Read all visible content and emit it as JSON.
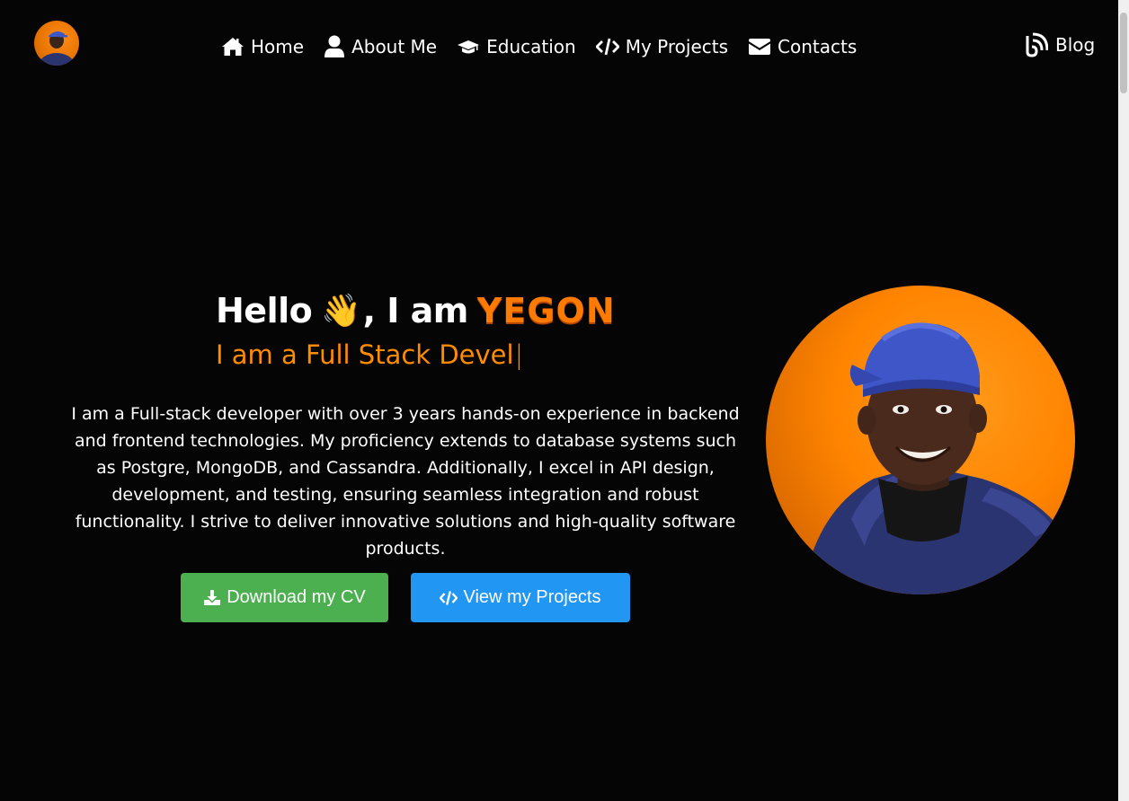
{
  "nav": {
    "logo_alt": "avatar",
    "items": [
      {
        "label": "Home",
        "icon": "home-icon"
      },
      {
        "label": "About Me",
        "icon": "user-icon"
      },
      {
        "label": "Education",
        "icon": "graduation-cap-icon"
      },
      {
        "label": "My Projects",
        "icon": "code-icon"
      },
      {
        "label": "Contacts",
        "icon": "envelope-icon"
      }
    ],
    "blog": {
      "label": "Blog",
      "icon": "blog-icon"
    }
  },
  "hero": {
    "greeting_prefix": "Hello",
    "wave_emoji": "👋",
    "greeting_mid": ", I am",
    "name": "YEGON",
    "typed_text": "I am a Full Stack Devel",
    "cursor": "|",
    "bio": "I am a Full-stack developer with over 3 years hands-on experience in backend and frontend technologies. My proficiency extends to database systems such as Postgre, MongoDB, and Cassandra. Additionally, I excel in API design, development, and testing, ensuring seamless integration and robust functionality. I strive to deliver innovative solutions and high-quality software products.",
    "cv_button": "Download my CV",
    "projects_button": "View my Projects"
  },
  "colors": {
    "background": "#050505",
    "accent": "#ff7a00",
    "cv_button": "#4caf50",
    "projects_button": "#2196f3"
  }
}
